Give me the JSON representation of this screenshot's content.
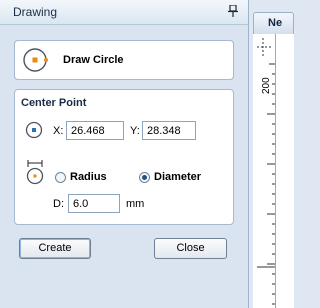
{
  "panel": {
    "title": "Drawing"
  },
  "tool": {
    "label": "Draw Circle"
  },
  "center_point": {
    "title": "Center Point",
    "x_label": "X:",
    "x_value": "26.468",
    "y_label": "Y:",
    "y_value": "28.348"
  },
  "size": {
    "radius_label": "Radius",
    "diameter_label": "Diameter",
    "selected": "Diameter",
    "d_label": "D:",
    "d_value": "6.0",
    "unit": "mm"
  },
  "buttons": {
    "create": "Create",
    "close": "Close"
  },
  "document_tab": {
    "label": "Ne"
  },
  "ruler": {
    "value": "200"
  },
  "colors": {
    "accent": "#1f4f86",
    "panel_bg": "#d9e4f0",
    "icon_orange": "#e88a1a"
  }
}
